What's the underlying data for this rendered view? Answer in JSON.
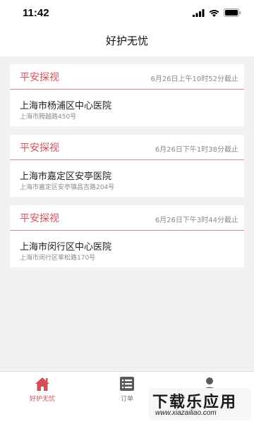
{
  "status_bar": {
    "time": "11:42"
  },
  "nav": {
    "title": "好护无忧"
  },
  "cards": [
    {
      "title": "平安探视",
      "deadline": "6月26日上午10时52分截止",
      "hospital": "上海市杨浦区中心医院",
      "address": "上海市腾越路450号"
    },
    {
      "title": "平安探视",
      "deadline": "6月26日下午1时38分截止",
      "hospital": "上海市嘉定区安亭医院",
      "address": "上海市嘉定区安亭镇昌吉路204号"
    },
    {
      "title": "平安探视",
      "deadline": "6月26日下午3时44分截止",
      "hospital": "上海市闵行区中心医院",
      "address": "上海市闵行区莘松路170号"
    }
  ],
  "tab_bar": {
    "tabs": [
      {
        "label": "好护无忧",
        "icon": "home-icon",
        "active": true
      },
      {
        "label": "订单",
        "icon": "order-list-icon",
        "active": false
      },
      {
        "label": "",
        "icon": "profile-icon",
        "active": false
      }
    ]
  },
  "watermark": {
    "main": "下载乐应用",
    "sub": "www.xiazailiao.com"
  },
  "colors": {
    "accent": "#d0505a",
    "background": "#f1f1f1",
    "divider": "#d98a8f"
  }
}
